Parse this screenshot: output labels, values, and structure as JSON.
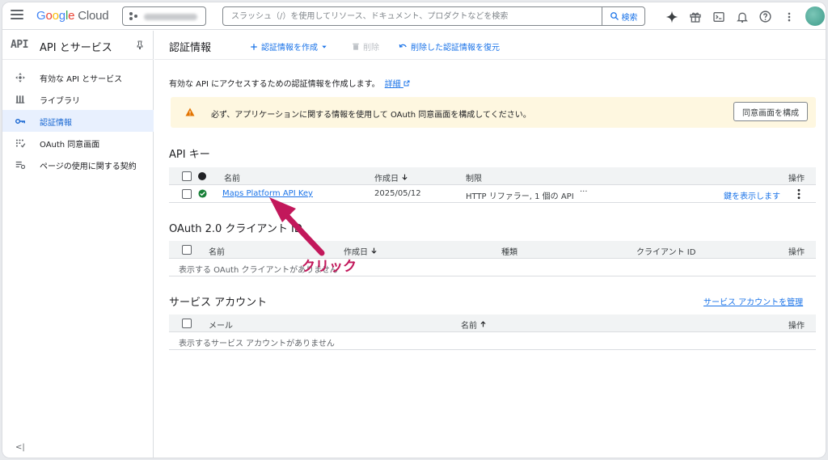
{
  "topbar": {
    "logo_google": "Google",
    "logo_cloud": "Cloud",
    "search_placeholder": "スラッシュ（/）を使用してリソース、ドキュメント、プロダクトなどを検索",
    "search_button": "検索"
  },
  "sidebar": {
    "mark": "API",
    "title": "API とサービス",
    "items": [
      {
        "label": "有効な API とサービス",
        "icon": "enabled-apis-icon"
      },
      {
        "label": "ライブラリ",
        "icon": "library-icon"
      },
      {
        "label": "認証情報",
        "icon": "key-icon",
        "active": true
      },
      {
        "label": "OAuth 同意画面",
        "icon": "oauth-consent-icon"
      },
      {
        "label": "ページの使用に関する契約",
        "icon": "agreements-icon"
      }
    ],
    "collapse": "<|"
  },
  "main": {
    "title": "認証情報",
    "actions": {
      "create": "認証情報を作成",
      "delete": "削除",
      "restore": "削除した認証情報を復元"
    },
    "intro": "有効な API にアクセスするための認証情報を作成します。",
    "intro_link": "詳細",
    "banner": {
      "message": "必ず、アプリケーションに関する情報を使用して OAuth 同意画面を構成してください。",
      "button": "同意画面を構成"
    },
    "api_keys": {
      "title": "API キー",
      "headers": {
        "name": "名前",
        "created": "作成日",
        "restrictions": "制限",
        "actions": "操作"
      },
      "rows": [
        {
          "name": "Maps Platform API Key",
          "created": "2025/05/12",
          "restrictions": "HTTP リファラー, 1 個の API",
          "more": "···",
          "show_key": "鍵を表示します"
        }
      ]
    },
    "oauth": {
      "title": "OAuth 2.0 クライアント ID",
      "headers": {
        "name": "名前",
        "created": "作成日",
        "type": "種類",
        "client_id": "クライアント ID",
        "actions": "操作"
      },
      "empty": "表示する OAuth クライアントがありません"
    },
    "service_accounts": {
      "title": "サービス アカウント",
      "manage": "サービス アカウントを管理",
      "headers": {
        "email": "メール",
        "name": "名前",
        "actions": "操作"
      },
      "empty": "表示するサービス アカウントがありません"
    }
  },
  "annotation": {
    "label": "クリック",
    "color": "#c2185b"
  }
}
